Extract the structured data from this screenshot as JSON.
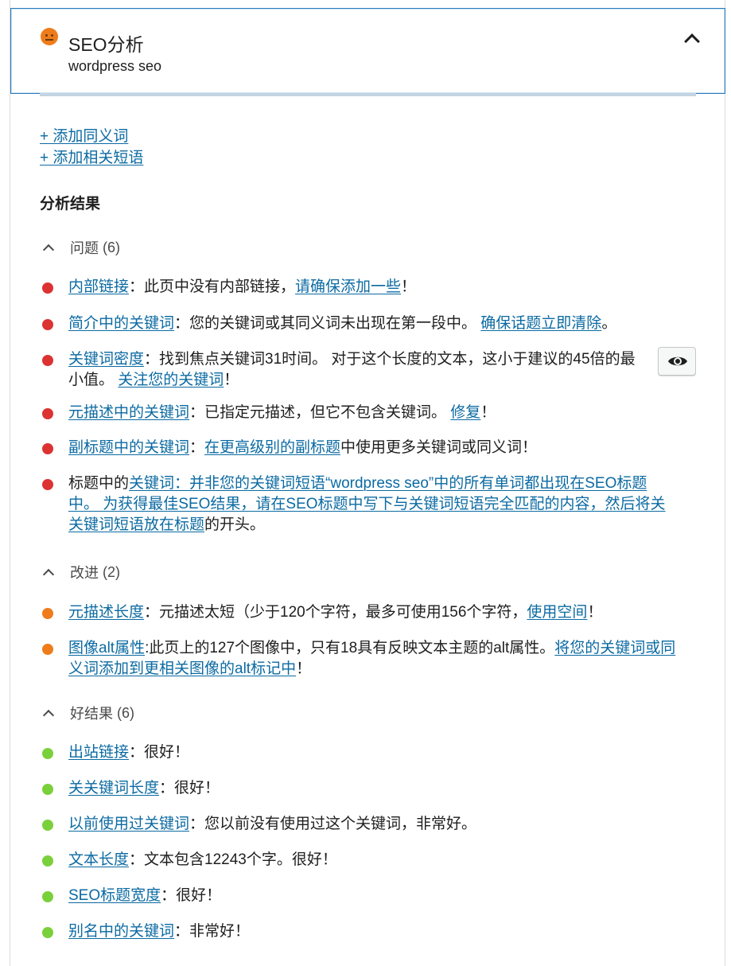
{
  "header": {
    "title": "SEO分析",
    "subtitle": "wordpress seo",
    "status_color": "#ee7c1b"
  },
  "add_links": {
    "synonym": "+ 添加同义词",
    "related": "+ 添加相关短语"
  },
  "results_title": "分析结果",
  "groups": {
    "problems": {
      "label": "问题",
      "count": "(6)",
      "items": [
        {
          "link": "内部链接",
          "text": "：此页中没有内部链接，",
          "link2": "请确保添加一些",
          "tail": "！"
        },
        {
          "link": "简介中的关键词",
          "text": "：您的关键词或其同义词未出现在第一段中。 ",
          "link2": "确保话题立即清除",
          "tail": "。"
        },
        {
          "link": "关键词密度",
          "text": "：找到焦点关键词31时间。 对于这个长度的文本，这小于建议的45倍的最小值。 ",
          "link2": "关注您的关键词",
          "tail": "！"
        },
        {
          "link": "元描述中的关键词",
          "text": "：已指定元描述，但它不包含关键词。 ",
          "link2": "修复",
          "tail": "！"
        },
        {
          "link": "副标题中的关键词",
          "text": "：",
          "link2": "在更高级别的副标题",
          "tail": "中使用更多关键词或同义词！"
        },
        {
          "pre": "标题中的",
          "link": "关键词：并非您的关键词短语“wordpress seo”中的所有单词都出现在SEO标题中。 为获得最佳SEO结果，请在SEO标题中写下与关键词短语完全匹配的内容，然后将关关键词短语放在标题",
          "tail": "的开头。"
        }
      ]
    },
    "improvements": {
      "label": "改进",
      "count": "(2)",
      "items": [
        {
          "link": "元描述长度",
          "text": "：元描述太短（少于120个字符，最多可使用156个字符，",
          "link2": "使用空间",
          "tail": "！"
        },
        {
          "link": "图像alt属性",
          "text": ":此页上的127个图像中，只有18具有反映文本主题的alt属性。",
          "link2": "将您的关键词或同义词添加到更相关图像的alt标记中",
          "tail": "！"
        }
      ]
    },
    "good": {
      "label": "好结果",
      "count": "(6)",
      "items": [
        {
          "link": "出站链接",
          "text": "：很好！"
        },
        {
          "link": "关关键词长度",
          "text": "：很好！"
        },
        {
          "link": "以前使用过关键词",
          "text": "：您以前没有使用过这个关键词，非常好。"
        },
        {
          "link": "文本长度",
          "text": "：文本包含12243个字。很好！"
        },
        {
          "link": "SEO标题宽度",
          "text": "：很好！"
        },
        {
          "link": "别名中的关键词",
          "text": "：非常好！"
        }
      ]
    }
  },
  "colors": {
    "link": "#0b6aa2",
    "bad": "#dc3232",
    "ok": "#ee7c1b",
    "good": "#7ad03a"
  },
  "icons": {
    "header_status": "neutral-face-icon",
    "collapse": "chevron-up-icon",
    "preview": "eye-icon"
  }
}
